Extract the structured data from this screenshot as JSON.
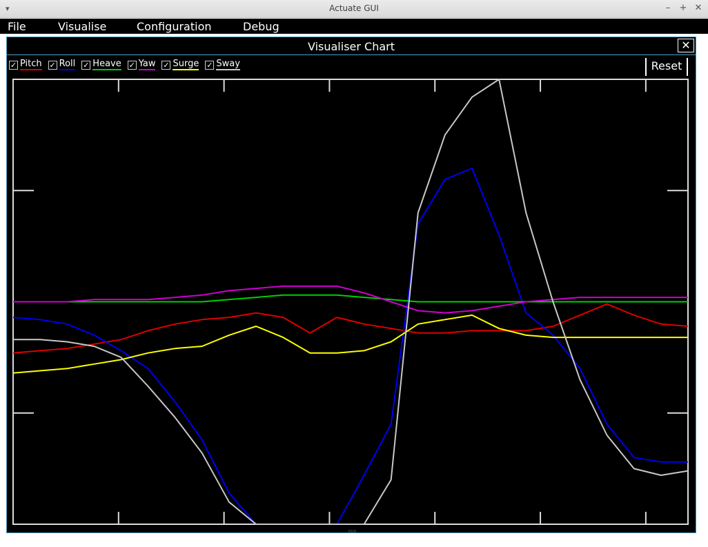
{
  "window": {
    "title": "Actuate GUI"
  },
  "menu": {
    "items": [
      "File",
      "Visualise",
      "Configuration",
      "Debug"
    ]
  },
  "panel": {
    "title": "Visualiser Chart",
    "close_label": "✕",
    "reset_label": "Reset"
  },
  "legend": [
    {
      "label": "Pitch",
      "color": "#e00000",
      "checked": true
    },
    {
      "label": "Roll",
      "color": "#0000ee",
      "checked": true
    },
    {
      "label": "Heave",
      "color": "#00d000",
      "checked": true
    },
    {
      "label": "Yaw",
      "color": "#d000d0",
      "checked": true
    },
    {
      "label": "Surge",
      "color": "#ffff00",
      "checked": true
    },
    {
      "label": "Sway",
      "color": "#c8c8c8",
      "checked": true
    }
  ],
  "chart_data": {
    "type": "line",
    "x": [
      0,
      4,
      8,
      12,
      16,
      20,
      24,
      28,
      32,
      36,
      40,
      44,
      48,
      52,
      56,
      60,
      64,
      68,
      72,
      76,
      80,
      84,
      88,
      92,
      96,
      100
    ],
    "ylim": [
      -1,
      1
    ],
    "grid": false,
    "series": [
      {
        "name": "Pitch",
        "color": "#e00000",
        "values": [
          -0.23,
          -0.22,
          -0.21,
          -0.19,
          -0.17,
          -0.13,
          -0.1,
          -0.08,
          -0.07,
          -0.05,
          -0.07,
          -0.14,
          -0.07,
          -0.1,
          -0.12,
          -0.14,
          -0.14,
          -0.13,
          -0.13,
          -0.13,
          -0.11,
          -0.06,
          -0.01,
          -0.06,
          -0.1,
          -0.11
        ]
      },
      {
        "name": "Roll",
        "color": "#0000ee",
        "values": [
          -0.07,
          -0.08,
          -0.1,
          -0.15,
          -0.22,
          -0.3,
          -0.45,
          -0.62,
          -0.86,
          -1.0,
          -1.0,
          -1.0,
          -1.0,
          -0.78,
          -0.55,
          0.35,
          0.55,
          0.6,
          0.3,
          -0.05,
          -0.15,
          -0.3,
          -0.55,
          -0.7,
          -0.72,
          -0.72
        ]
      },
      {
        "name": "Heave",
        "color": "#00d000",
        "values": [
          0.0,
          0.0,
          0.0,
          0.0,
          0.0,
          0.0,
          0.0,
          0.0,
          0.01,
          0.02,
          0.03,
          0.03,
          0.03,
          0.02,
          0.01,
          0.0,
          0.0,
          0.0,
          0.0,
          0.0,
          0.0,
          0.0,
          0.0,
          0.0,
          0.0,
          0.0
        ]
      },
      {
        "name": "Yaw",
        "color": "#d000d0",
        "values": [
          0.0,
          0.0,
          0.0,
          0.01,
          0.01,
          0.01,
          0.02,
          0.03,
          0.05,
          0.06,
          0.07,
          0.07,
          0.07,
          0.04,
          0.0,
          -0.04,
          -0.05,
          -0.04,
          -0.02,
          0.0,
          0.01,
          0.02,
          0.02,
          0.02,
          0.02,
          0.02
        ]
      },
      {
        "name": "Surge",
        "color": "#ffff00",
        "values": [
          -0.32,
          -0.31,
          -0.3,
          -0.28,
          -0.26,
          -0.23,
          -0.21,
          -0.2,
          -0.15,
          -0.11,
          -0.16,
          -0.23,
          -0.23,
          -0.22,
          -0.18,
          -0.1,
          -0.08,
          -0.06,
          -0.12,
          -0.15,
          -0.16,
          -0.16,
          -0.16,
          -0.16,
          -0.16,
          -0.16
        ]
      },
      {
        "name": "Sway",
        "color": "#c8c8c8",
        "values": [
          -0.17,
          -0.17,
          -0.18,
          -0.2,
          -0.25,
          -0.38,
          -0.52,
          -0.68,
          -0.9,
          -1.0,
          -1.0,
          -1.0,
          -1.0,
          -1.0,
          -0.8,
          0.4,
          0.75,
          0.92,
          1.0,
          0.4,
          0.0,
          -0.35,
          -0.6,
          -0.75,
          -0.78,
          -0.76
        ]
      }
    ]
  }
}
